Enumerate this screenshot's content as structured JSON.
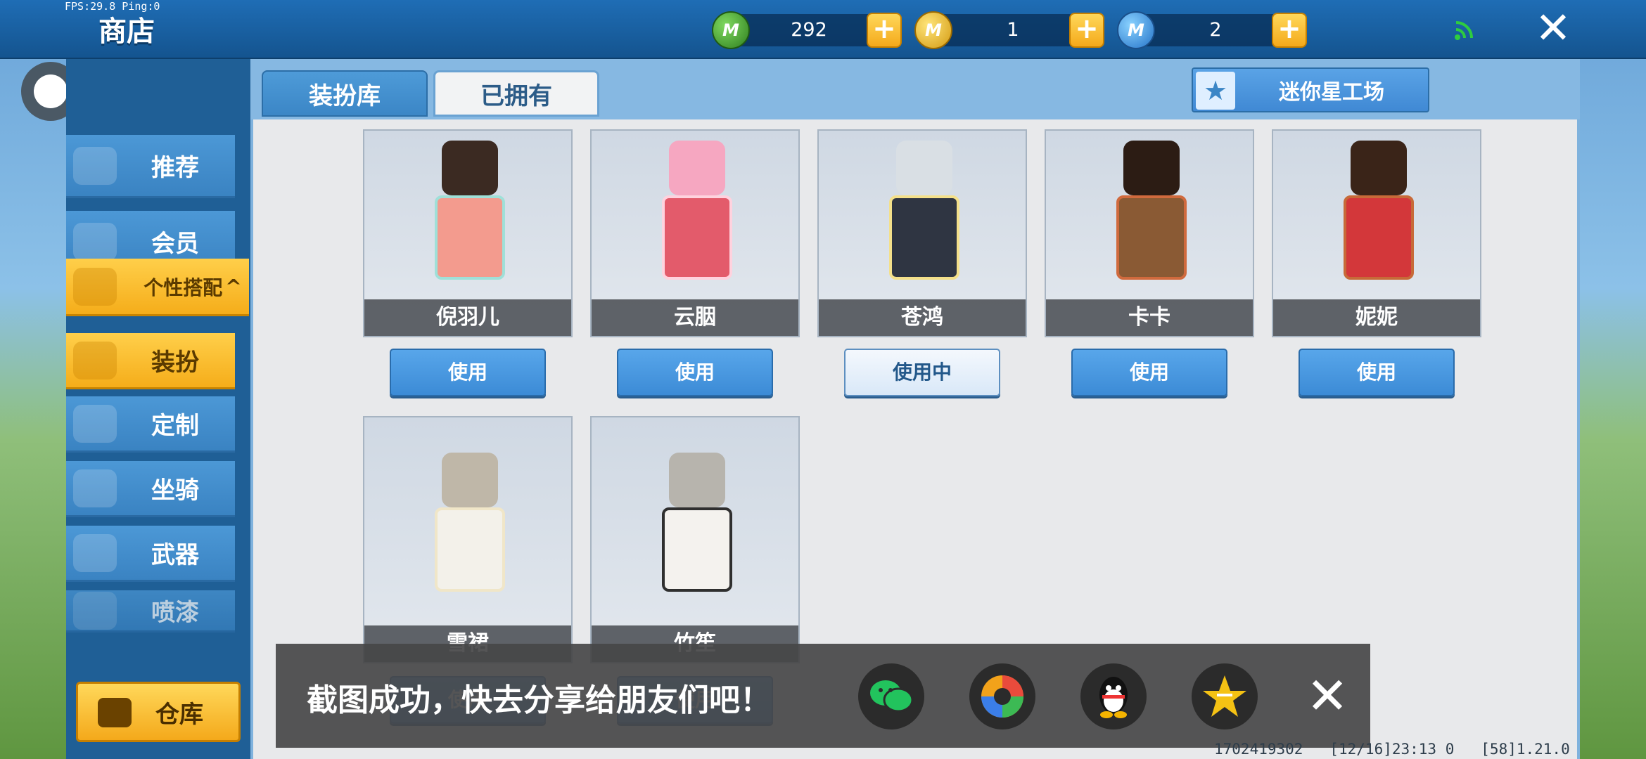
{
  "debug": {
    "fps": "FPS:29.8  Ping:0"
  },
  "header": {
    "title": "商店"
  },
  "currencies": [
    {
      "icon": "green-minicoin-icon",
      "value": "292",
      "color": "#3e9a2a"
    },
    {
      "icon": "gold-minibean-icon",
      "value": "1",
      "color": "#e6b21c"
    },
    {
      "icon": "blue-star-coin-icon",
      "value": "2",
      "color": "#3aa0e8"
    }
  ],
  "sidebar": {
    "items": [
      {
        "label": "推荐"
      },
      {
        "label": "会员"
      },
      {
        "label": "个性搭配"
      }
    ],
    "subitems": [
      {
        "label": "装扮"
      },
      {
        "label": "定制"
      },
      {
        "label": "坐骑"
      },
      {
        "label": "武器"
      },
      {
        "label": "喷漆"
      }
    ],
    "warehouse": "仓库"
  },
  "tabs": {
    "wardrobe": "装扮库",
    "owned": "已拥有"
  },
  "workshop": {
    "label": "迷你星工场"
  },
  "skins": [
    {
      "name": "倪羽儿",
      "button": "使用",
      "hair": "#3b2a22",
      "outfit": "#f39b8e",
      "accent": "#9fe0d8"
    },
    {
      "name": "云胭",
      "button": "使用",
      "hair": "#f6a7c1",
      "outfit": "#e35b6b",
      "accent": "#ffd2de"
    },
    {
      "name": "苍鸿",
      "button": "使用中",
      "hair": "#d9dfe4",
      "outfit": "#2f3542",
      "accent": "#f4e08a"
    },
    {
      "name": "卡卡",
      "button": "使用",
      "hair": "#2c1c14",
      "outfit": "#8a5a34",
      "accent": "#d06a3d"
    },
    {
      "name": "妮妮",
      "button": "使用",
      "hair": "#3a2418",
      "outfit": "#d3373a",
      "accent": "#c76a38"
    },
    {
      "name": "雪裙",
      "button": "使用",
      "hair": "#bfb7a8",
      "outfit": "#f3f1ea",
      "accent": "#f0e6c8"
    },
    {
      "name": "竹笙",
      "button": "使用",
      "hair": "#b7b4ad",
      "outfit": "#f4f2ee",
      "accent": "#2f2f2f"
    }
  ],
  "share": {
    "message": "截图成功，快去分享给朋友们吧！",
    "targets": [
      {
        "icon": "wechat-icon",
        "color": "#22c35d"
      },
      {
        "icon": "moments-icon",
        "color": "#f2a21a"
      },
      {
        "icon": "qq-icon",
        "color": "#111111"
      },
      {
        "icon": "qzone-icon",
        "color": "#f5c214"
      }
    ]
  },
  "footer": {
    "info": "1702419302   [12/16]23:13 0   [58]1.21.0"
  }
}
